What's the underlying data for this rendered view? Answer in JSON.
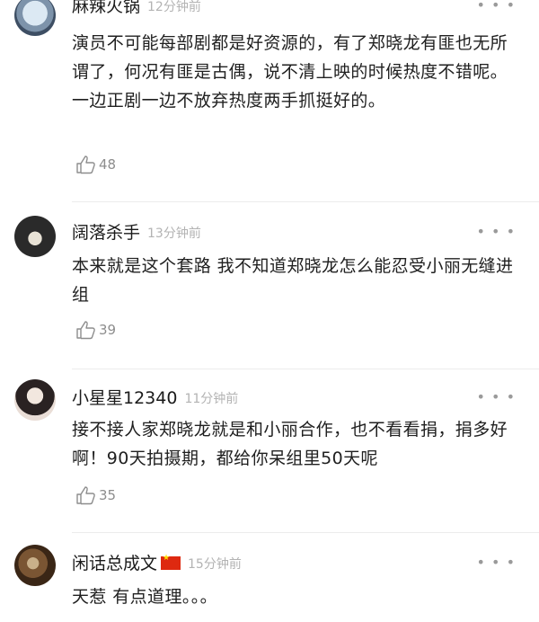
{
  "comments": [
    {
      "name": "麻辣火锅",
      "time": "12分钟前",
      "text": "演员不可能每部剧都是好资源的，有了郑晓龙有匪也无所谓了，何况有匪是古偶，说不清上映的时候热度不错呢。一边正剧一边不放弃热度两手抓挺好的。",
      "likes": "48",
      "avatar_colors": [
        "#bcd3e6",
        "#3d4e63"
      ]
    },
    {
      "name": "阔落杀手",
      "time": "13分钟前",
      "text": "本来就是这个套路 我不知道郑晓龙怎么能忍受小丽无缝进组",
      "likes": "39",
      "avatar_colors": [
        "#1f1f1f",
        "#d9d2c4"
      ]
    },
    {
      "name": "小星星12340",
      "time": "11分钟前",
      "text": "接不接人家郑晓龙就是和小丽合作，也不看看捐，捐多好啊！90天拍摄期，都给你呆组里50天呢",
      "likes": "35",
      "avatar_colors": [
        "#e9ddd6",
        "#2a2222"
      ]
    },
    {
      "name": "闲话总成文",
      "time": "15分钟前",
      "text": "天惹 有点道理。。。",
      "likes": "",
      "avatar_colors": [
        "#5a3b22",
        "#c9b08a"
      ]
    }
  ],
  "more_glyph": "• • •"
}
